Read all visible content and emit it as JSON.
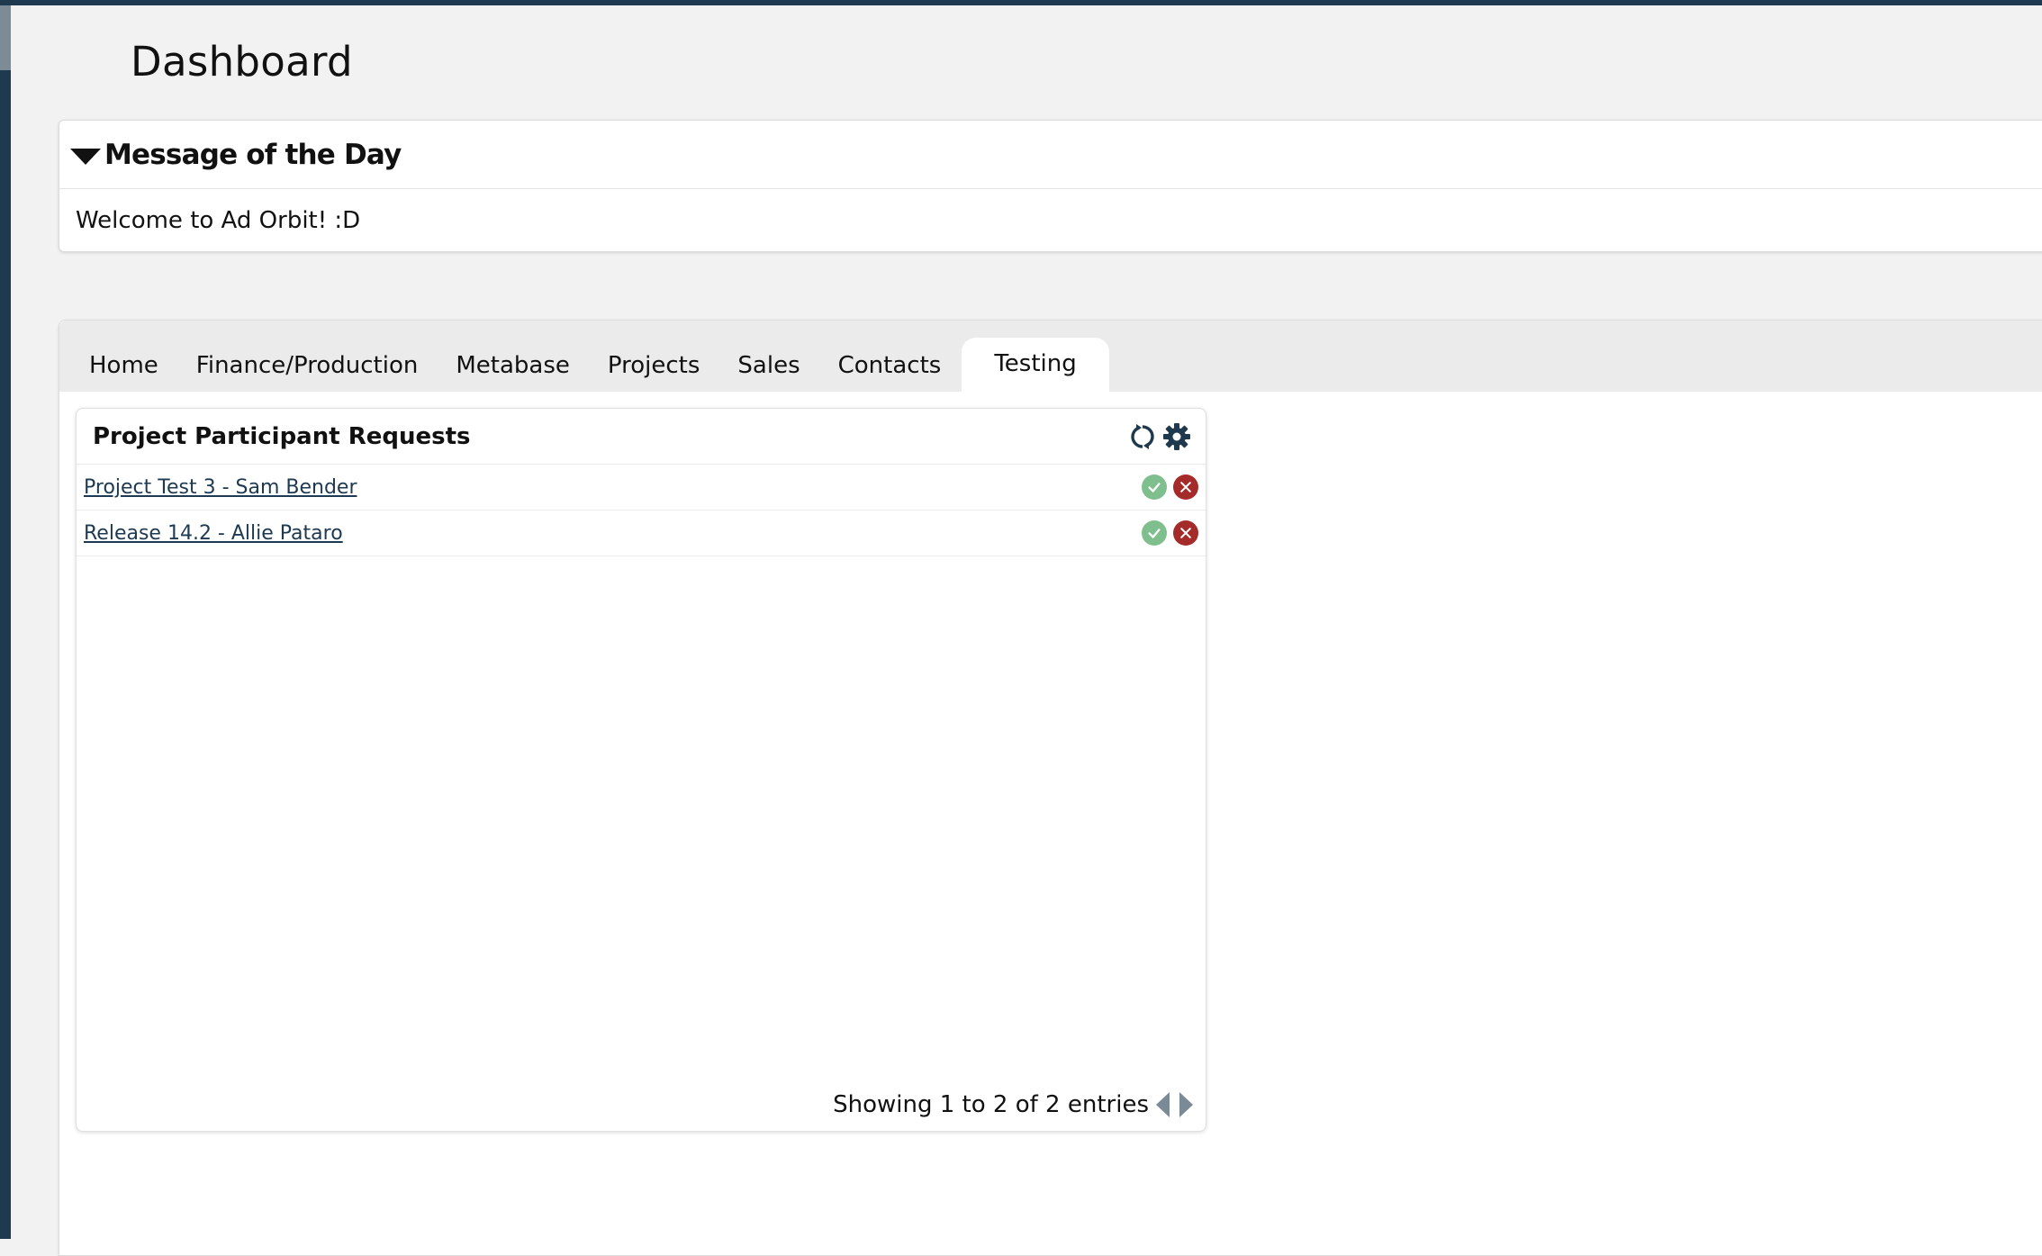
{
  "page": {
    "title": "Dashboard"
  },
  "motd": {
    "title": "Message of the Day",
    "body": "Welcome to Ad Orbit! :D"
  },
  "tabs": [
    {
      "label": "Home",
      "active": false
    },
    {
      "label": "Finance/Production",
      "active": false
    },
    {
      "label": "Metabase",
      "active": false
    },
    {
      "label": "Projects",
      "active": false
    },
    {
      "label": "Sales",
      "active": false
    },
    {
      "label": "Contacts",
      "active": false
    },
    {
      "label": "Testing",
      "active": true
    }
  ],
  "widget": {
    "title": "Project Participant Requests",
    "icons": [
      "refresh-icon",
      "gear-icon"
    ],
    "rows": [
      {
        "label": "Project Test 3 - Sam Bender"
      },
      {
        "label": "Release 14.2 - Allie Pataro"
      }
    ],
    "footer": "Showing 1 to 2 of 2 entries"
  },
  "colors": {
    "nav_dark": "#1f3a4f",
    "approve": "#7fbf8e",
    "reject": "#a52a2a",
    "link": "#1e3a52"
  }
}
